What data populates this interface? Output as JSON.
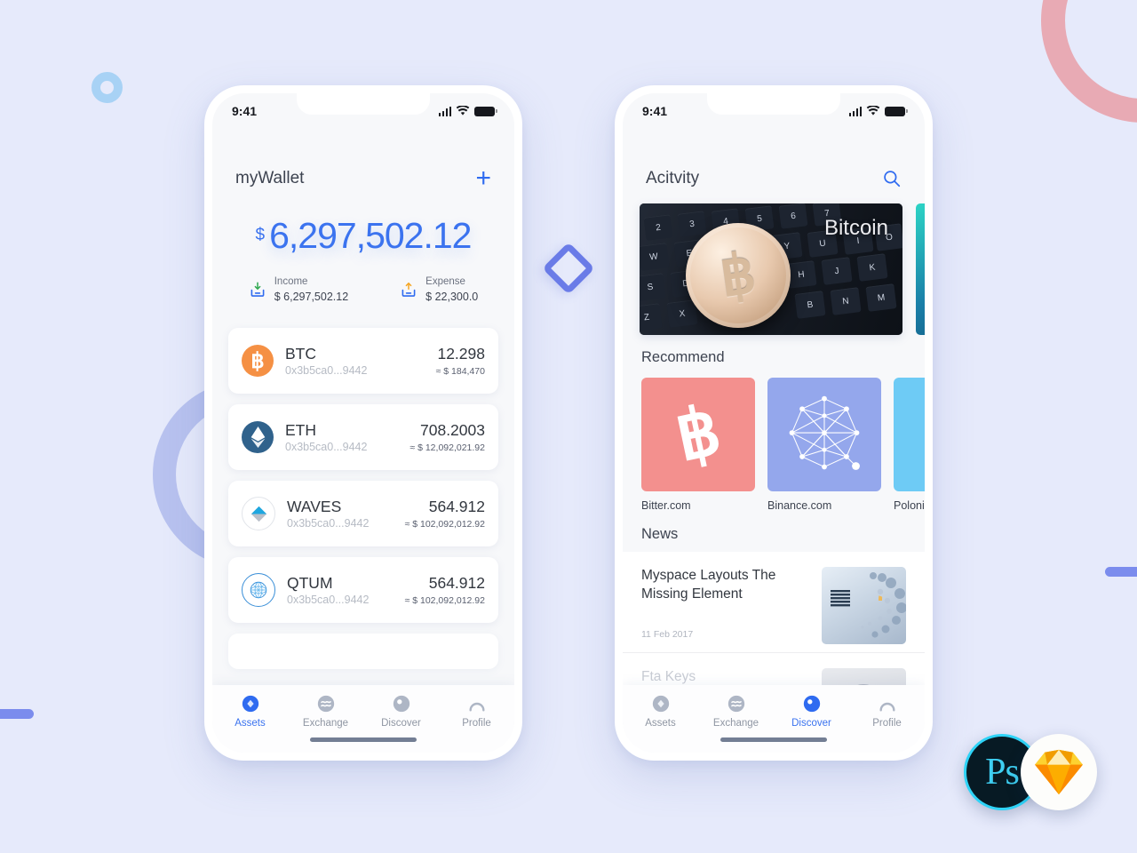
{
  "background": {
    "color": "#e6eafb",
    "decorations": [
      {
        "name": "small-blue-ring",
        "color": "#a8d2f5"
      },
      {
        "name": "pink-ring",
        "color": "#e8aab4"
      },
      {
        "name": "periwinkle-ring",
        "color": "#b8c2ef"
      },
      {
        "name": "blue-bar-left",
        "color": "#7b8ced"
      },
      {
        "name": "blue-bar-right",
        "color": "#7b8ced"
      },
      {
        "name": "blue-diamond",
        "color": "#6b7ce8"
      }
    ]
  },
  "logos": {
    "photoshop_label": "Ps",
    "photoshop_bg": "#071a24",
    "photoshop_accent": "#3ecff2",
    "sketch_accent": "#f7a823"
  },
  "phone1": {
    "status": {
      "time": "9:41",
      "signal_icon": "signal-bars-icon",
      "wifi_icon": "wifi-icon",
      "battery_icon": "battery-icon"
    },
    "header": {
      "title": "myWallet",
      "add_icon": "plus-icon",
      "add_label": "+"
    },
    "balance": {
      "currency": "$",
      "amount": "6,297,502.12",
      "color": "#3b73ef"
    },
    "income": {
      "icon": "income-tray-down-icon",
      "label": "Income",
      "value": "$ 6,297,502.12"
    },
    "expense": {
      "icon": "expense-tray-up-icon",
      "label": "Expense",
      "value": "$ 22,300.0"
    },
    "assets": [
      {
        "icon": "btc-coin-icon",
        "symbol": "BTC",
        "address": "0x3b5ca0...9442",
        "qty": "12.298",
        "usd": "≈ $ 184,470"
      },
      {
        "icon": "eth-coin-icon",
        "symbol": "ETH",
        "address": "0x3b5ca0...9442",
        "qty": "708.2003",
        "usd": "≈ $ 12,092,021.92"
      },
      {
        "icon": "waves-coin-icon",
        "symbol": "WAVES",
        "address": "0x3b5ca0...9442",
        "qty": "564.912",
        "usd": "≈ $ 102,092,012.92"
      },
      {
        "icon": "qtum-coin-icon",
        "symbol": "QTUM",
        "address": "0x3b5ca0...9442",
        "qty": "564.912",
        "usd": "≈ $ 102,092,012.92"
      }
    ],
    "tabs": [
      {
        "icon": "assets-diamond-icon",
        "label": "Assets",
        "active": true
      },
      {
        "icon": "exchange-waves-icon",
        "label": "Exchange",
        "active": false
      },
      {
        "icon": "discover-compass-icon",
        "label": "Discover",
        "active": false
      },
      {
        "icon": "profile-person-icon",
        "label": "Profile",
        "active": false
      }
    ]
  },
  "phone2": {
    "status": {
      "time": "9:41",
      "signal_icon": "signal-bars-icon",
      "wifi_icon": "wifi-icon",
      "battery_icon": "battery-icon"
    },
    "header": {
      "title": "Acitvity",
      "search_icon": "search-icon"
    },
    "hero": {
      "caption": "Bitcoin"
    },
    "recommend_heading": "Recommend",
    "recommend": [
      {
        "icon": "bitcoin-b-icon",
        "name": "Bitter.com",
        "color": "#f3908e"
      },
      {
        "icon": "network-graph-icon",
        "name": "Binance.com",
        "color": "#94a7ec"
      },
      {
        "icon": "poloniex-icon",
        "name": "Poloniex.com",
        "color": "#6ecbf5"
      }
    ],
    "news_heading": "News",
    "news": [
      {
        "title": "Myspace Layouts The Missing Element",
        "date": "11 Feb 2017",
        "thumb": "ibm-server-thumb"
      },
      {
        "title": "Fta Keys",
        "date": "",
        "thumb": "person-thumb"
      }
    ],
    "tabs": [
      {
        "icon": "assets-diamond-icon",
        "label": "Assets",
        "active": false
      },
      {
        "icon": "exchange-waves-icon",
        "label": "Exchange",
        "active": false
      },
      {
        "icon": "discover-compass-icon",
        "label": "Discover",
        "active": true
      },
      {
        "icon": "profile-person-icon",
        "label": "Profile",
        "active": false
      }
    ]
  }
}
